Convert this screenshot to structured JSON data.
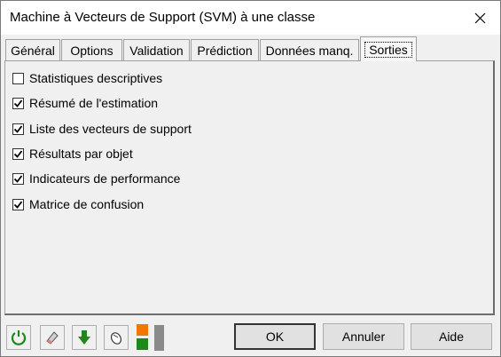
{
  "window": {
    "title": "Machine à Vecteurs de Support (SVM) à une classe"
  },
  "tabs": [
    {
      "label": "Général"
    },
    {
      "label": "Options"
    },
    {
      "label": "Validation"
    },
    {
      "label": "Prédiction"
    },
    {
      "label": "Données manq."
    },
    {
      "label": "Sorties",
      "active": true
    }
  ],
  "options": [
    {
      "label": "Statistiques descriptives",
      "checked": false
    },
    {
      "label": "Résumé de l'estimation",
      "checked": true
    },
    {
      "label": "Liste des vecteurs de support",
      "checked": true
    },
    {
      "label": "Résultats par objet",
      "checked": true
    },
    {
      "label": "Indicateurs de performance",
      "checked": true
    },
    {
      "label": "Matrice de confusion",
      "checked": true
    }
  ],
  "footer": {
    "icons": [
      "reset-icon",
      "eraser-icon",
      "down-arrow-icon",
      "mouse-icon"
    ],
    "colors": {
      "orange": "#f07800",
      "green": "#1a8a1a"
    },
    "ok_label": "OK",
    "cancel_label": "Annuler",
    "help_label": "Aide"
  }
}
